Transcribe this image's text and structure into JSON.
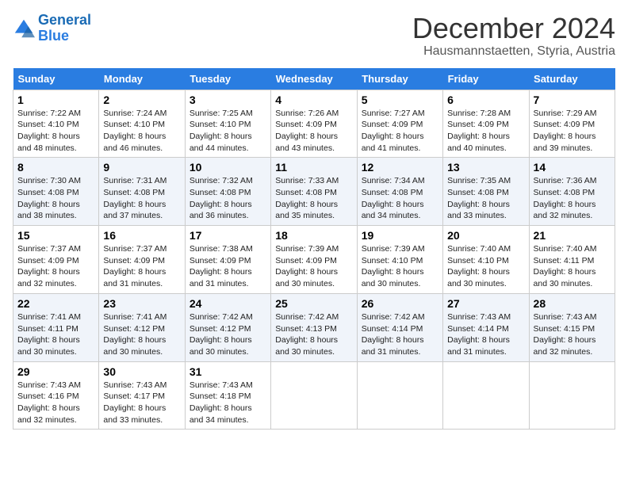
{
  "header": {
    "logo_line1": "General",
    "logo_line2": "Blue",
    "month": "December 2024",
    "location": "Hausmannstaetten, Styria, Austria"
  },
  "days_of_week": [
    "Sunday",
    "Monday",
    "Tuesday",
    "Wednesday",
    "Thursday",
    "Friday",
    "Saturday"
  ],
  "weeks": [
    [
      {
        "day": "1",
        "sunrise": "7:22 AM",
        "sunset": "4:10 PM",
        "daylight": "8 hours and 48 minutes."
      },
      {
        "day": "2",
        "sunrise": "7:24 AM",
        "sunset": "4:10 PM",
        "daylight": "8 hours and 46 minutes."
      },
      {
        "day": "3",
        "sunrise": "7:25 AM",
        "sunset": "4:10 PM",
        "daylight": "8 hours and 44 minutes."
      },
      {
        "day": "4",
        "sunrise": "7:26 AM",
        "sunset": "4:09 PM",
        "daylight": "8 hours and 43 minutes."
      },
      {
        "day": "5",
        "sunrise": "7:27 AM",
        "sunset": "4:09 PM",
        "daylight": "8 hours and 41 minutes."
      },
      {
        "day": "6",
        "sunrise": "7:28 AM",
        "sunset": "4:09 PM",
        "daylight": "8 hours and 40 minutes."
      },
      {
        "day": "7",
        "sunrise": "7:29 AM",
        "sunset": "4:09 PM",
        "daylight": "8 hours and 39 minutes."
      }
    ],
    [
      {
        "day": "8",
        "sunrise": "7:30 AM",
        "sunset": "4:08 PM",
        "daylight": "8 hours and 38 minutes."
      },
      {
        "day": "9",
        "sunrise": "7:31 AM",
        "sunset": "4:08 PM",
        "daylight": "8 hours and 37 minutes."
      },
      {
        "day": "10",
        "sunrise": "7:32 AM",
        "sunset": "4:08 PM",
        "daylight": "8 hours and 36 minutes."
      },
      {
        "day": "11",
        "sunrise": "7:33 AM",
        "sunset": "4:08 PM",
        "daylight": "8 hours and 35 minutes."
      },
      {
        "day": "12",
        "sunrise": "7:34 AM",
        "sunset": "4:08 PM",
        "daylight": "8 hours and 34 minutes."
      },
      {
        "day": "13",
        "sunrise": "7:35 AM",
        "sunset": "4:08 PM",
        "daylight": "8 hours and 33 minutes."
      },
      {
        "day": "14",
        "sunrise": "7:36 AM",
        "sunset": "4:08 PM",
        "daylight": "8 hours and 32 minutes."
      }
    ],
    [
      {
        "day": "15",
        "sunrise": "7:37 AM",
        "sunset": "4:09 PM",
        "daylight": "8 hours and 32 minutes."
      },
      {
        "day": "16",
        "sunrise": "7:37 AM",
        "sunset": "4:09 PM",
        "daylight": "8 hours and 31 minutes."
      },
      {
        "day": "17",
        "sunrise": "7:38 AM",
        "sunset": "4:09 PM",
        "daylight": "8 hours and 31 minutes."
      },
      {
        "day": "18",
        "sunrise": "7:39 AM",
        "sunset": "4:09 PM",
        "daylight": "8 hours and 30 minutes."
      },
      {
        "day": "19",
        "sunrise": "7:39 AM",
        "sunset": "4:10 PM",
        "daylight": "8 hours and 30 minutes."
      },
      {
        "day": "20",
        "sunrise": "7:40 AM",
        "sunset": "4:10 PM",
        "daylight": "8 hours and 30 minutes."
      },
      {
        "day": "21",
        "sunrise": "7:40 AM",
        "sunset": "4:11 PM",
        "daylight": "8 hours and 30 minutes."
      }
    ],
    [
      {
        "day": "22",
        "sunrise": "7:41 AM",
        "sunset": "4:11 PM",
        "daylight": "8 hours and 30 minutes."
      },
      {
        "day": "23",
        "sunrise": "7:41 AM",
        "sunset": "4:12 PM",
        "daylight": "8 hours and 30 minutes."
      },
      {
        "day": "24",
        "sunrise": "7:42 AM",
        "sunset": "4:12 PM",
        "daylight": "8 hours and 30 minutes."
      },
      {
        "day": "25",
        "sunrise": "7:42 AM",
        "sunset": "4:13 PM",
        "daylight": "8 hours and 30 minutes."
      },
      {
        "day": "26",
        "sunrise": "7:42 AM",
        "sunset": "4:14 PM",
        "daylight": "8 hours and 31 minutes."
      },
      {
        "day": "27",
        "sunrise": "7:43 AM",
        "sunset": "4:14 PM",
        "daylight": "8 hours and 31 minutes."
      },
      {
        "day": "28",
        "sunrise": "7:43 AM",
        "sunset": "4:15 PM",
        "daylight": "8 hours and 32 minutes."
      }
    ],
    [
      {
        "day": "29",
        "sunrise": "7:43 AM",
        "sunset": "4:16 PM",
        "daylight": "8 hours and 32 minutes."
      },
      {
        "day": "30",
        "sunrise": "7:43 AM",
        "sunset": "4:17 PM",
        "daylight": "8 hours and 33 minutes."
      },
      {
        "day": "31",
        "sunrise": "7:43 AM",
        "sunset": "4:18 PM",
        "daylight": "8 hours and 34 minutes."
      },
      {
        "day": "",
        "sunrise": "",
        "sunset": "",
        "daylight": ""
      },
      {
        "day": "",
        "sunrise": "",
        "sunset": "",
        "daylight": ""
      },
      {
        "day": "",
        "sunrise": "",
        "sunset": "",
        "daylight": ""
      },
      {
        "day": "",
        "sunrise": "",
        "sunset": "",
        "daylight": ""
      }
    ]
  ]
}
